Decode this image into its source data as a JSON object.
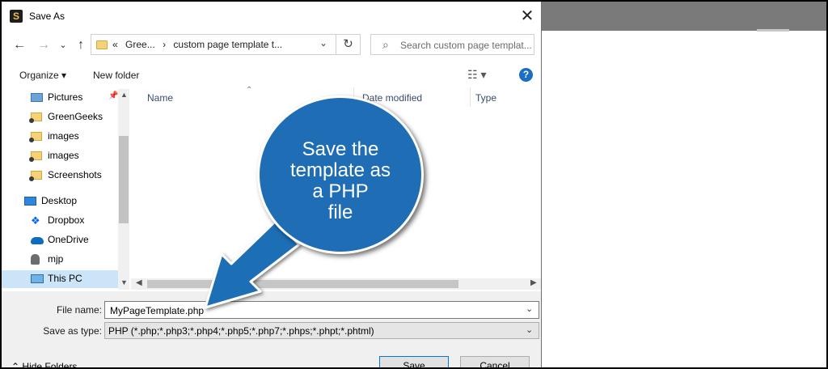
{
  "dialog": {
    "title": "Save As",
    "close_label": "✕"
  },
  "address_bar": {
    "breadcrumbs": [
      "«",
      "Gree...",
      "›",
      "custom page template t..."
    ]
  },
  "search": {
    "placeholder": "Search custom page templat..."
  },
  "toolbar": {
    "organize_label": "Organize ▾",
    "new_folder_label": "New folder"
  },
  "sidebar": {
    "items": [
      {
        "label": "Pictures",
        "icon": "pictures-icon",
        "pinned": true
      },
      {
        "label": "GreenGeeks",
        "icon": "folder-icon"
      },
      {
        "label": "images",
        "icon": "folder-icon"
      },
      {
        "label": "images",
        "icon": "folder-icon"
      },
      {
        "label": "Screenshots",
        "icon": "folder-icon"
      },
      {
        "label": "Desktop",
        "icon": "desktop-icon"
      },
      {
        "label": "Dropbox",
        "icon": "dropbox-icon"
      },
      {
        "label": "OneDrive",
        "icon": "onedrive-icon"
      },
      {
        "label": "mjp",
        "icon": "user-icon"
      },
      {
        "label": "This PC",
        "icon": "computer-icon",
        "selected": true
      }
    ]
  },
  "file_list": {
    "columns": [
      "Name",
      "Date modified",
      "Type"
    ]
  },
  "form": {
    "file_name_label": "File name:",
    "file_name_value": "MyPageTemplate.php",
    "save_type_label": "Save as type:",
    "save_type_value": "PHP (*.php;*.php3;*.php4;*.php5;*.php7;*.phps;*.phpt;*.phtml)",
    "hide_folders_label": "Hide Folders",
    "save_label": "Save",
    "cancel_label": "Cancel"
  },
  "callout": {
    "lines": [
      "Save the",
      "template as",
      "a PHP",
      "file"
    ],
    "color": "#1f6eb5"
  }
}
